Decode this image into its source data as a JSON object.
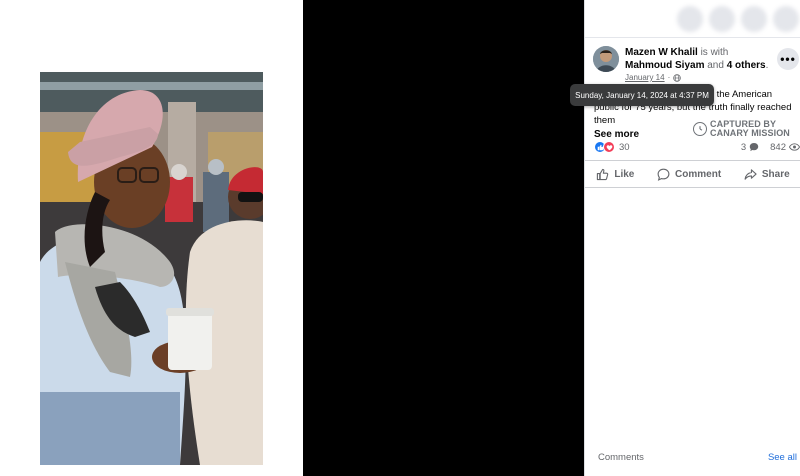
{
  "post": {
    "author": "Mazen W Khalil",
    "with_text": " is with ",
    "tagged": "Mahmoud Siyam",
    "and_text": " and ",
    "others": "4 others",
    "period": ".",
    "date": "January 14",
    "separator": "·",
    "privacy_icon": "globe-icon",
    "more_icon": "ellipsis-icon",
    "more_label": "•••",
    "text_line1": "from the American",
    "text_line2": "public for 75 years, but the truth finally reached",
    "text_line3": "them",
    "see_more": "See more"
  },
  "tooltip": {
    "text": "Sunday, January 14, 2024 at 4:37 PM"
  },
  "watermark": {
    "line1": "CAPTURED BY",
    "line2": "CANARY MISSION"
  },
  "stats": {
    "reactions": "30",
    "comments": "3",
    "views": "842",
    "comment_icon": "comment-bubble-icon",
    "view_icon": "eye-icon"
  },
  "actions": {
    "like": "Like",
    "comment": "Comment",
    "share": "Share"
  },
  "footer": {
    "comments_label": "Comments",
    "see_all": "See all"
  },
  "colors": {
    "facebook_blue": "#1877f2",
    "love_red": "#f33e58",
    "link_blue": "#216fdb",
    "tooltip_bg": "#3a3b3c"
  }
}
